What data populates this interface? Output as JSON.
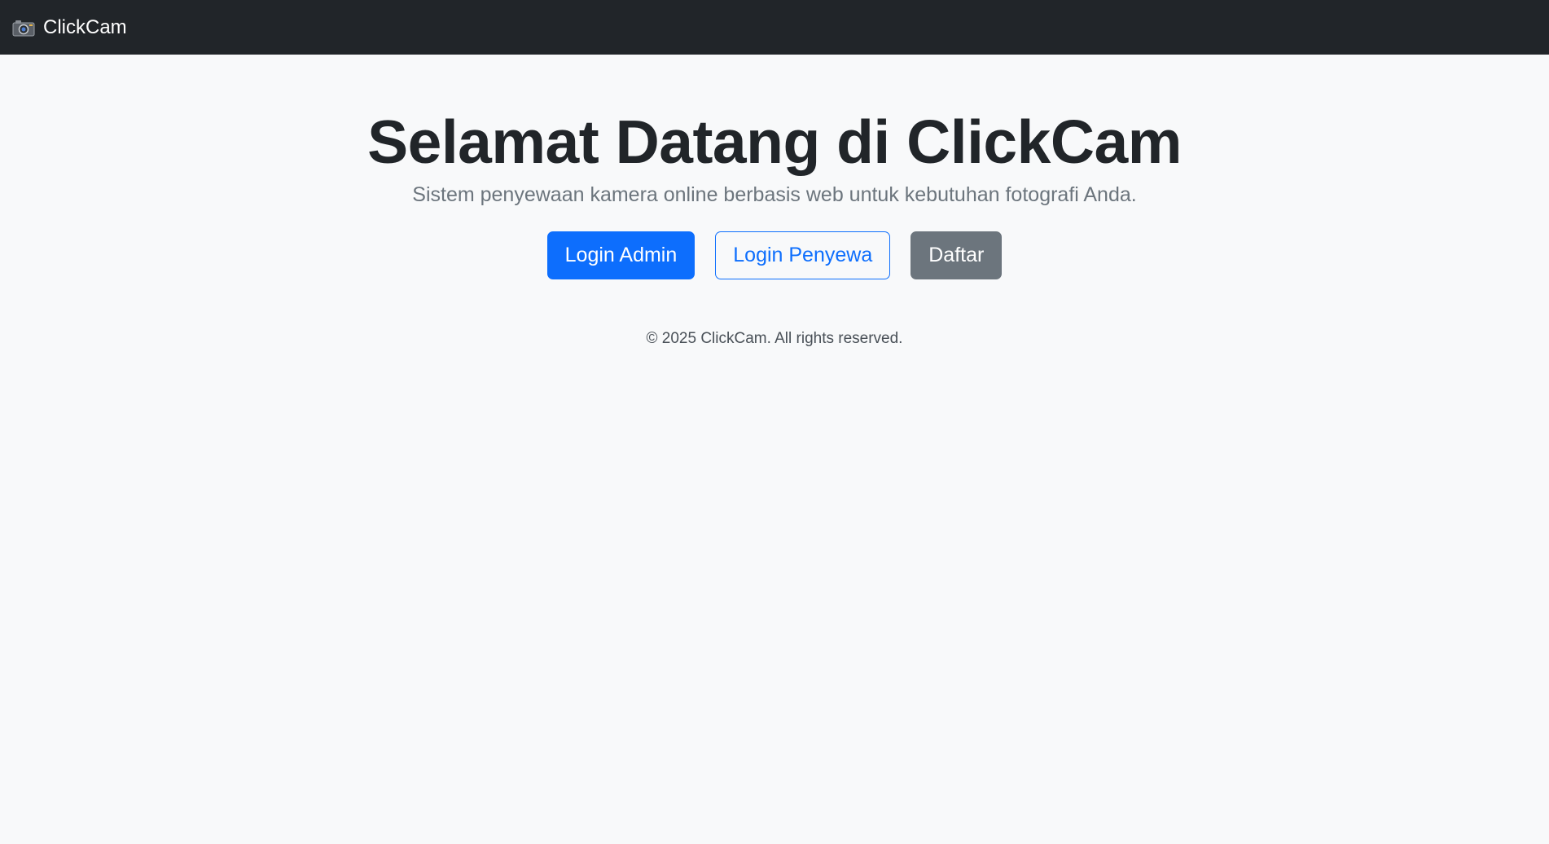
{
  "navbar": {
    "brand_icon": "camera-icon",
    "brand_label": "ClickCam"
  },
  "hero": {
    "title": "Selamat Datang di ClickCam",
    "subtitle": "Sistem penyewaan kamera online berbasis web untuk kebutuhan fotografi Anda."
  },
  "actions": {
    "login_admin": "Login Admin",
    "login_penyewa": "Login Penyewa",
    "daftar": "Daftar"
  },
  "footer": {
    "text": "© 2025 ClickCam. All rights reserved."
  },
  "colors": {
    "navbar_bg": "#212529",
    "page_bg": "#f8f9fa",
    "primary": "#0d6efd",
    "secondary": "#6c757d"
  }
}
